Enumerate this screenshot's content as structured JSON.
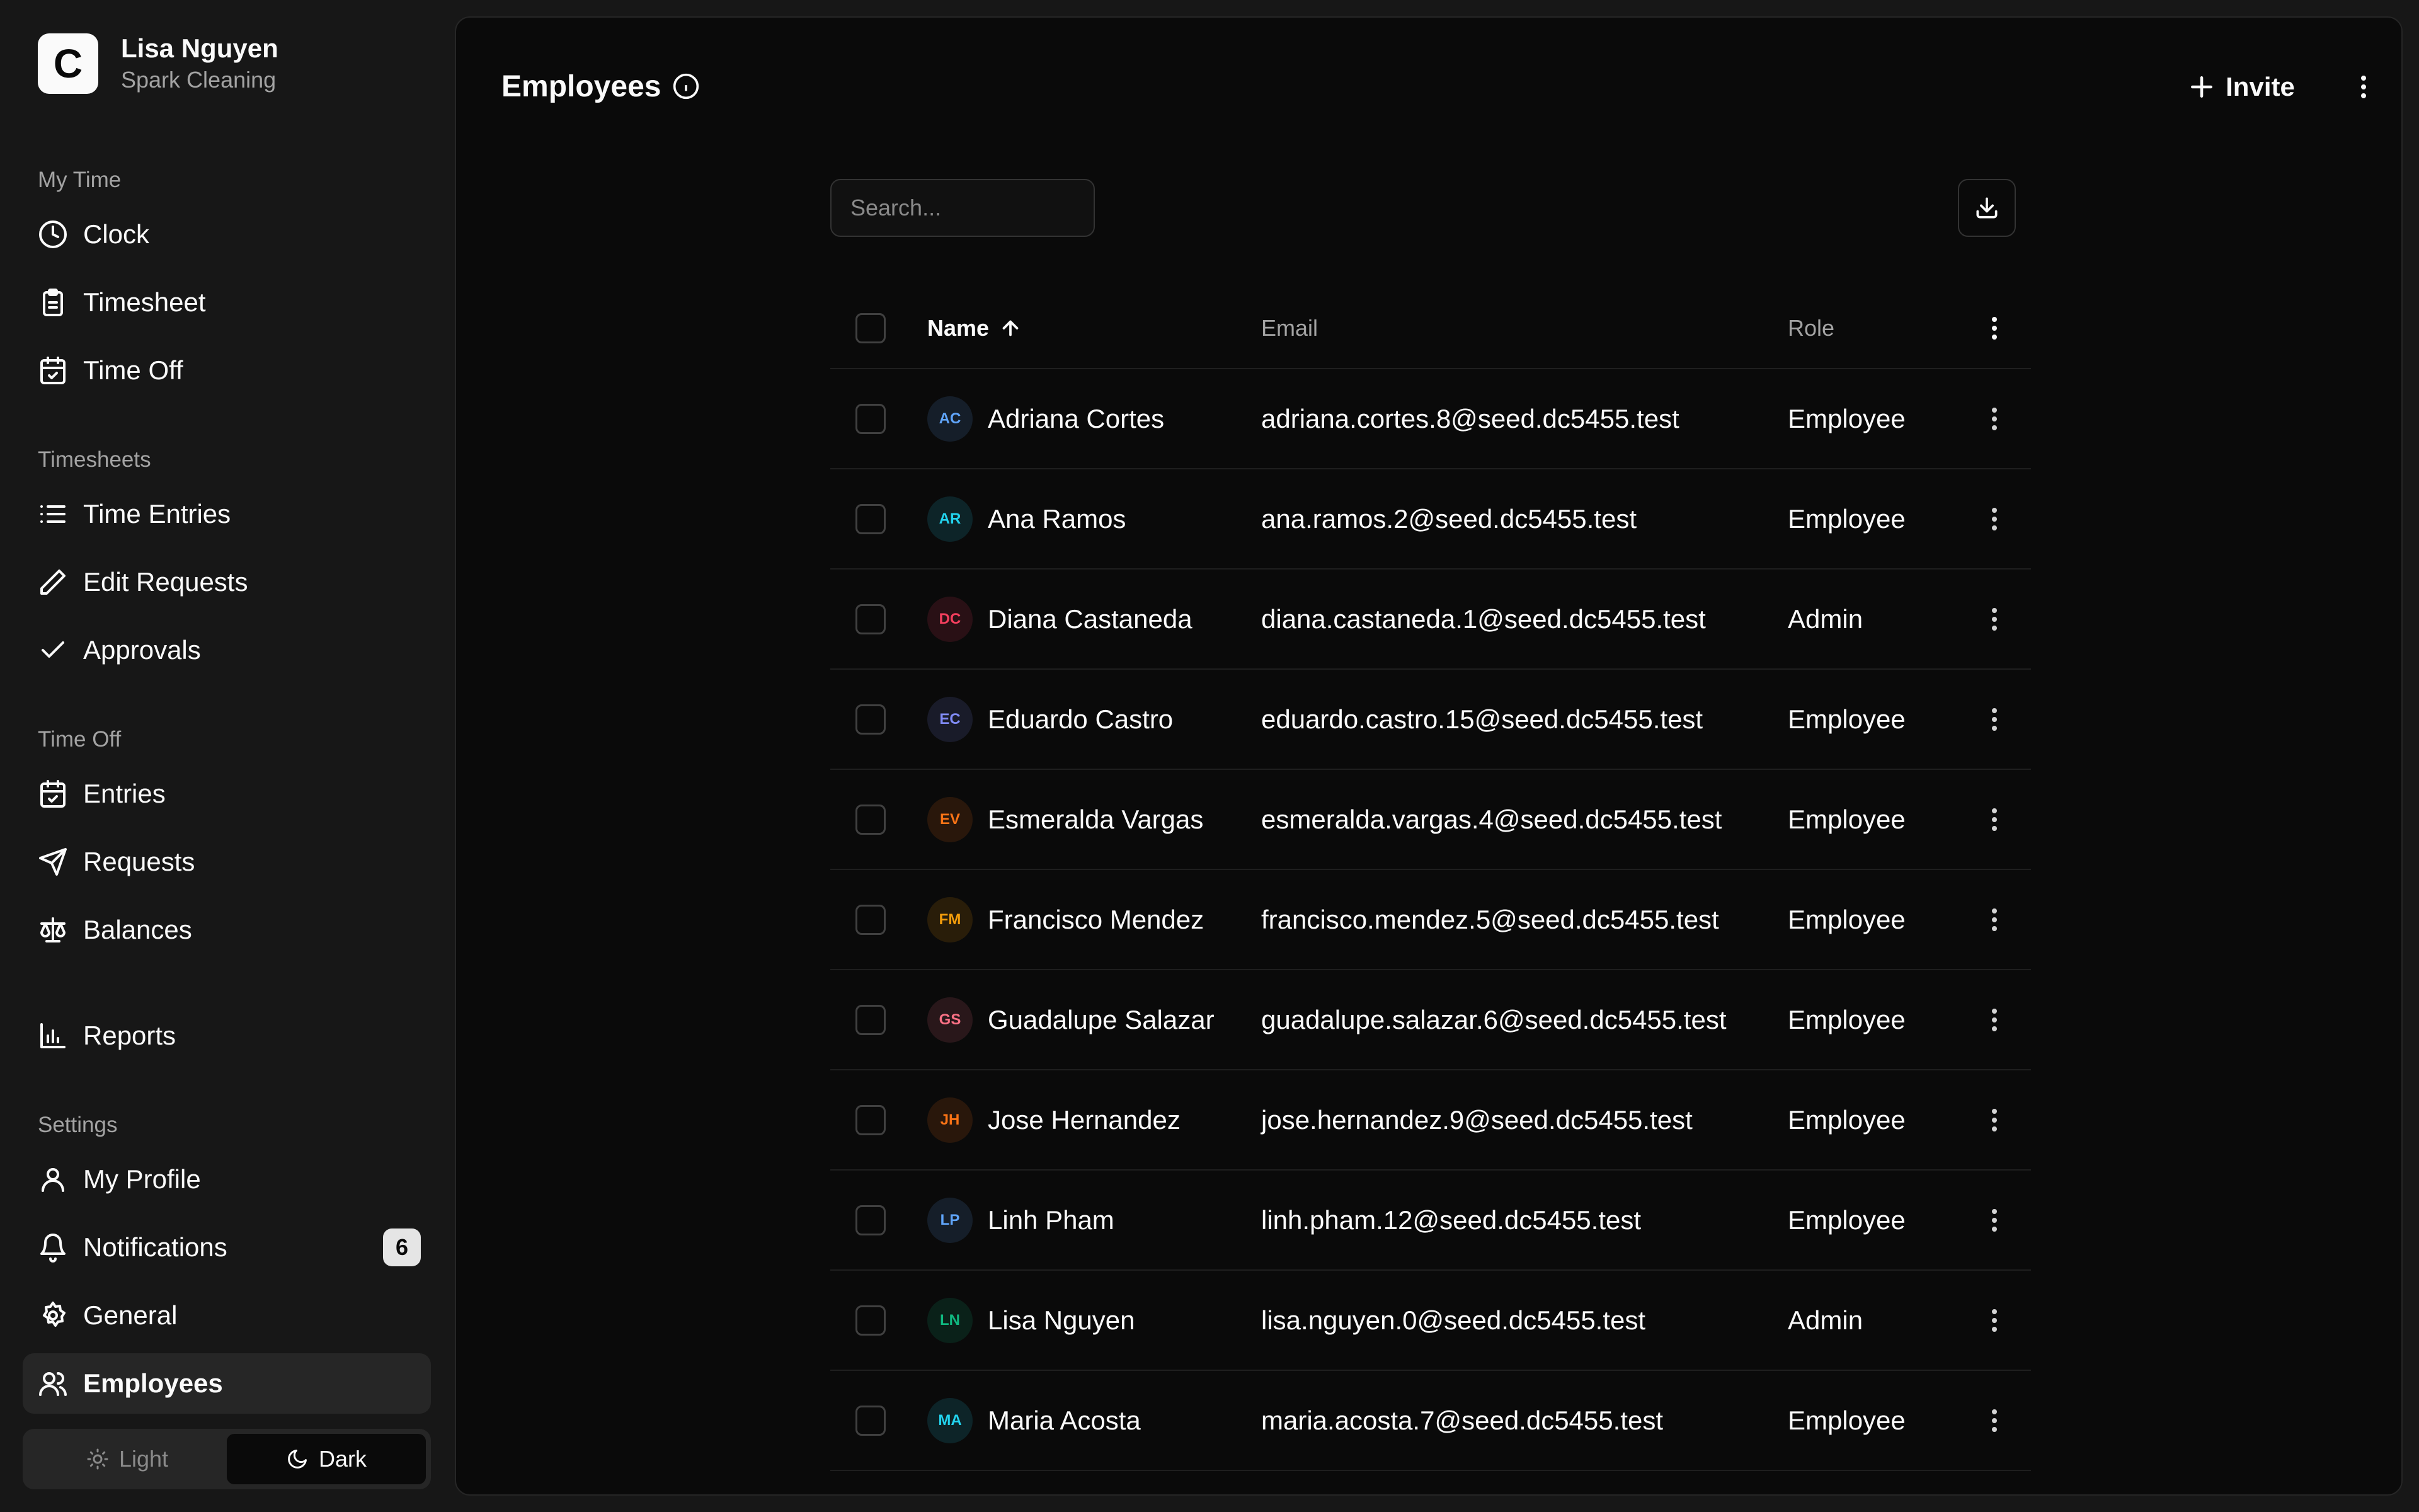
{
  "org": {
    "logo_letter": "C",
    "user_name": "Lisa Nguyen",
    "company": "Spark Cleaning"
  },
  "nav": {
    "my_time_label": "My Time",
    "clock": "Clock",
    "timesheet": "Timesheet",
    "time_off_top": "Time Off",
    "timesheets_label": "Timesheets",
    "time_entries": "Time Entries",
    "edit_requests": "Edit Requests",
    "approvals": "Approvals",
    "time_off_label": "Time Off",
    "entries": "Entries",
    "requests": "Requests",
    "balances": "Balances",
    "reports": "Reports",
    "settings_label": "Settings",
    "my_profile": "My Profile",
    "notifications": "Notifications",
    "notifications_count": "6",
    "general": "General",
    "employees": "Employees"
  },
  "theme": {
    "light": "Light",
    "dark": "Dark",
    "selected": "Dark"
  },
  "page": {
    "title": "Employees",
    "invite_label": "Invite"
  },
  "search": {
    "placeholder": "Search...",
    "value": ""
  },
  "table": {
    "headers": {
      "name": "Name",
      "email": "Email",
      "role": "Role"
    },
    "sort": {
      "column": "Name",
      "direction": "ascending"
    },
    "rows": [
      {
        "initials": "AC",
        "name": "Adriana Cortes",
        "email": "adriana.cortes.8@seed.dc5455.test",
        "role": "Employee",
        "color": "#60a5fa"
      },
      {
        "initials": "AR",
        "name": "Ana Ramos",
        "email": "ana.ramos.2@seed.dc5455.test",
        "role": "Employee",
        "color": "#22d3ee"
      },
      {
        "initials": "DC",
        "name": "Diana Castaneda",
        "email": "diana.castaneda.1@seed.dc5455.test",
        "role": "Admin",
        "color": "#f43f5e"
      },
      {
        "initials": "EC",
        "name": "Eduardo Castro",
        "email": "eduardo.castro.15@seed.dc5455.test",
        "role": "Employee",
        "color": "#818cf8"
      },
      {
        "initials": "EV",
        "name": "Esmeralda Vargas",
        "email": "esmeralda.vargas.4@seed.dc5455.test",
        "role": "Employee",
        "color": "#f97316"
      },
      {
        "initials": "FM",
        "name": "Francisco Mendez",
        "email": "francisco.mendez.5@seed.dc5455.test",
        "role": "Employee",
        "color": "#f59e0b"
      },
      {
        "initials": "GS",
        "name": "Guadalupe Salazar",
        "email": "guadalupe.salazar.6@seed.dc5455.test",
        "role": "Employee",
        "color": "#fb7185"
      },
      {
        "initials": "JH",
        "name": "Jose Hernandez",
        "email": "jose.hernandez.9@seed.dc5455.test",
        "role": "Employee",
        "color": "#f97316"
      },
      {
        "initials": "LP",
        "name": "Linh Pham",
        "email": "linh.pham.12@seed.dc5455.test",
        "role": "Employee",
        "color": "#60a5fa"
      },
      {
        "initials": "LN",
        "name": "Lisa Nguyen",
        "email": "lisa.nguyen.0@seed.dc5455.test",
        "role": "Admin",
        "color": "#10b981"
      },
      {
        "initials": "MA",
        "name": "Maria Acosta",
        "email": "maria.acosta.7@seed.dc5455.test",
        "role": "Employee",
        "color": "#22d3ee"
      }
    ]
  }
}
